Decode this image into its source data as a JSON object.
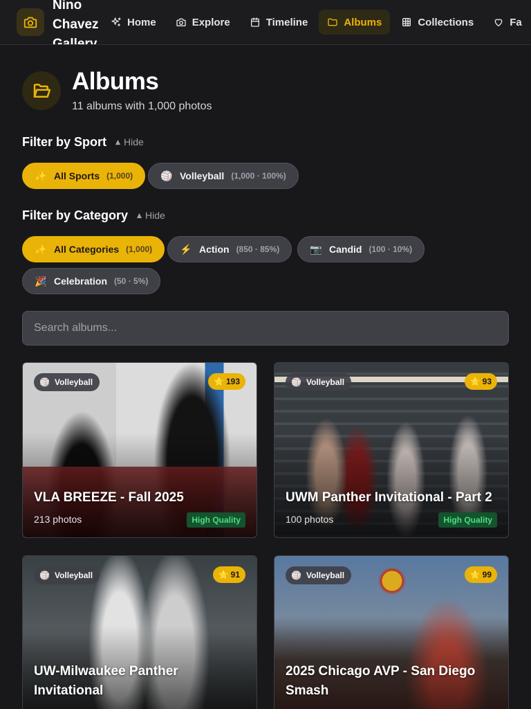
{
  "brand": {
    "name": "Nino Chavez Gallery",
    "icon": "camera-icon"
  },
  "nav": [
    {
      "label": "Home",
      "icon": "sparkles-icon",
      "active": false
    },
    {
      "label": "Explore",
      "icon": "camera-icon",
      "active": false
    },
    {
      "label": "Timeline",
      "icon": "calendar-icon",
      "active": false
    },
    {
      "label": "Albums",
      "icon": "folder-icon",
      "active": true
    },
    {
      "label": "Collections",
      "icon": "grid-icon",
      "active": false
    },
    {
      "label": "Fa",
      "icon": "heart-icon",
      "active": false
    }
  ],
  "header": {
    "title": "Albums",
    "subtitle": "11 albums with 1,000 photos",
    "icon": "folder-open-icon"
  },
  "sport_filter": {
    "label": "Filter by Sport",
    "toggle": "Hide",
    "chips": [
      {
        "emoji": "✨",
        "label": "All Sports",
        "count": "(1,000)",
        "active": true
      },
      {
        "emoji": "🏐",
        "label": "Volleyball",
        "count": "(1,000 · 100%)",
        "active": false
      }
    ]
  },
  "category_filter": {
    "label": "Filter by Category",
    "toggle": "Hide",
    "chips": [
      {
        "emoji": "✨",
        "label": "All Categories",
        "count": "(1,000)",
        "active": true
      },
      {
        "emoji": "⚡",
        "label": "Action",
        "count": "(850 · 85%)",
        "active": false
      },
      {
        "emoji": "📷",
        "label": "Candid",
        "count": "(100 · 10%)",
        "active": false
      },
      {
        "emoji": "🎉",
        "label": "Celebration",
        "count": "(50 · 5%)",
        "active": false
      }
    ]
  },
  "search": {
    "placeholder": "Search albums..."
  },
  "albums": [
    {
      "sport": "Volleyball",
      "rating": "193",
      "title": "VLA BREEZE - Fall 2025",
      "count": "213 photos",
      "badge": "High Quality"
    },
    {
      "sport": "Volleyball",
      "rating": "93",
      "title": "UWM Panther Invitational - Part 2",
      "count": "100 photos",
      "badge": "High Quality"
    },
    {
      "sport": "Volleyball",
      "rating": "91",
      "title": "UW-Milwaukee Panther Invitational",
      "count": "",
      "badge": ""
    },
    {
      "sport": "Volleyball",
      "rating": "99",
      "title": "2025 Chicago AVP - San Diego Smash",
      "count": "",
      "badge": ""
    }
  ],
  "colors": {
    "accent": "#eab308",
    "background": "#18181b",
    "chip": "#3f3f46",
    "quality_text": "#4ade80"
  }
}
